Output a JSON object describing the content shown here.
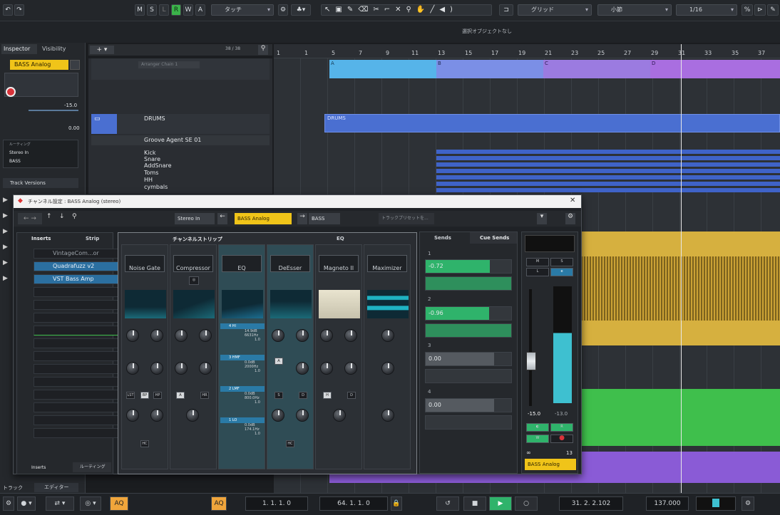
{
  "toolbar": {
    "modes": [
      "M",
      "S",
      "L",
      "R",
      "W",
      "A"
    ],
    "touch_mode": "タッチ",
    "grid_type": "グリッド",
    "bar_unit": "小節",
    "quantize": "1/16",
    "status_text": "選択オブジェクトなし"
  },
  "left_zone": {
    "tab_inspector": "Inspector",
    "tab_visibility": "Visibility",
    "track_name": "BASS Analog",
    "volume": "-15.0",
    "pan": "0.00",
    "input_label": "Stereo In",
    "output_label": "BASS",
    "routing_header": "ルーティング",
    "track_versions": "Track Versions",
    "bottom_tab_track": "トラック",
    "bottom_tab_editor": "エディター"
  },
  "project": {
    "track_count": "38 / 38",
    "arranger_label": "Arranger Chain 1",
    "drums_folder": "DRUMS",
    "groove_agent": "Groove Agent SE 01",
    "tracks": [
      "Kick",
      "Snare",
      "AddSnare",
      "Toms",
      "HH",
      "cymbals"
    ],
    "ruler": [
      "1",
      "1",
      "5",
      "7",
      "9",
      "11",
      "13",
      "15",
      "17",
      "19",
      "21",
      "23",
      "25",
      "27",
      "29",
      "31",
      "33",
      "35",
      "37"
    ],
    "arranger_sections": [
      "A",
      "B",
      "C",
      "D"
    ],
    "drums_part": "DRUMS"
  },
  "channel": {
    "title": "チャンネル設定 : BASS Analog (stereo)",
    "input": "Stereo In",
    "name": "BASS Analog",
    "output": "BASS",
    "track_preset": "トラックプリセットを...",
    "inserts_tab": "Inserts",
    "strip_tab": "Strip",
    "inserts": [
      "VintageCom...or",
      "Quadrafuzz v2",
      "VST Bass Amp"
    ],
    "strip_header": "チャンネルストリップ",
    "eq_header": "EQ",
    "strip_modules": [
      "Noise Gate",
      "Compressor",
      "EQ",
      "DeEsser",
      "Magneto II",
      "Maximizer"
    ],
    "sends_tab": "Sends",
    "cue_sends_tab": "Cue Sends",
    "sends": [
      {
        "num": "1",
        "value": "-0.72"
      },
      {
        "num": "2",
        "value": "-0.96"
      },
      {
        "num": "3",
        "value": "0.00"
      },
      {
        "num": "4",
        "value": "0.00"
      }
    ],
    "fader_value": "-15.0",
    "meter_value": "-13.0",
    "fader_channel_num": "13",
    "fader_name": "BASS Analog",
    "footer_inserts": "Inserts",
    "footer_routing": "ルーティング",
    "eq_bands": [
      {
        "label": "4 HI",
        "gain": "14.9dB",
        "freq": "6631Hz",
        "q": "1.0"
      },
      {
        "label": "3 HMF",
        "gain": "0.0dB",
        "freq": "2000Hz",
        "q": "1.0"
      },
      {
        "label": "2 LMF",
        "gain": "0.0dB",
        "freq": "800.0Hz",
        "q": "1.0"
      },
      {
        "label": "1 LO",
        "gain": "0.0dB",
        "freq": "174.1Hz",
        "q": "1.0"
      }
    ]
  },
  "transport": {
    "aq": "AQ",
    "left_locator": "1. 1. 1. 0",
    "right_locator": "64. 1. 1. 0",
    "position": "31. 2. 2.102",
    "tempo": "137.000"
  },
  "colors": {
    "accent_yellow": "#f0c419",
    "arranger_blue": "#56b4e9",
    "drums_blue": "#4a6fd1",
    "audio_gold": "#d6b03f",
    "midi_green": "#3fbf4c",
    "purple": "#8a5bd6"
  }
}
